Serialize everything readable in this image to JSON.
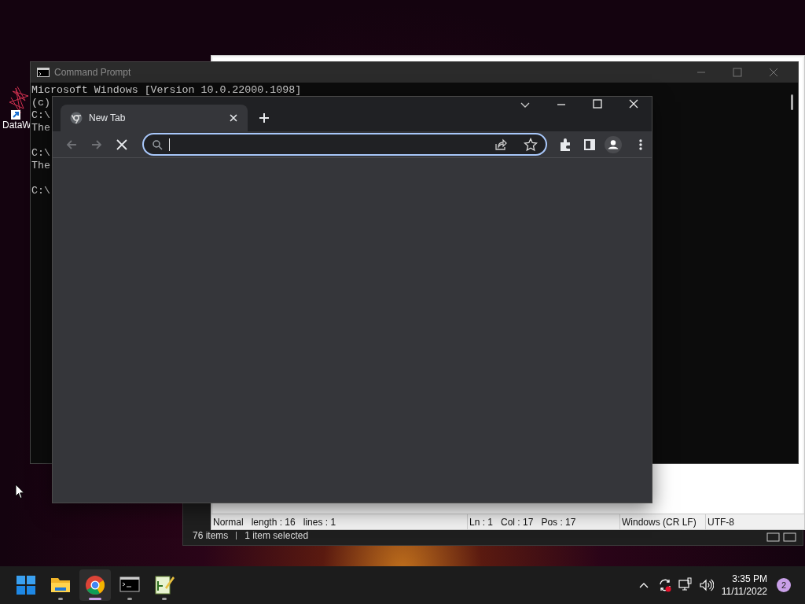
{
  "desktop": {
    "icons": [
      {
        "label": "DataW"
      }
    ]
  },
  "explorer": {
    "status": [
      "76 items",
      "1 item selected"
    ]
  },
  "notepad": {
    "status": [
      {
        "kind": "main",
        "texts": [
          "Normal",
          "length : 16",
          "lines : 1"
        ]
      },
      {
        "kind": "main",
        "texts": [
          "Ln : 1",
          "Col : 17",
          "Pos : 17"
        ]
      },
      {
        "kind": "main",
        "texts": [
          "Windows (CR LF)"
        ]
      },
      {
        "kind": "last",
        "texts": [
          "UTF-8"
        ]
      }
    ]
  },
  "cmd": {
    "title": "Command Prompt",
    "blocks": [
      [
        "Microsoft Windows [Version 10.0.22000.1098]",
        "(c)",
        "C:\\",
        "The"
      ],
      [
        "C:\\",
        "The"
      ],
      [
        "C:\\"
      ]
    ]
  },
  "chrome": {
    "tabs": [
      {
        "label": "New Tab",
        "selected": true
      }
    ],
    "nav": [
      {
        "kind": "back",
        "disabled": true
      },
      {
        "kind": "forward",
        "disabled": true
      },
      {
        "kind": "stop",
        "disabled": false
      }
    ],
    "address": {
      "focused": true
    }
  },
  "taskbar": {
    "apps": [
      {
        "kind": "start",
        "selected": false,
        "running": false
      },
      {
        "kind": "files",
        "selected": false,
        "running": true
      },
      {
        "kind": "browser",
        "selected": true,
        "running": true
      },
      {
        "kind": "terminal",
        "selected": false,
        "running": true
      },
      {
        "kind": "notepad",
        "selected": false,
        "running": true
      }
    ],
    "time": "3:35 PM",
    "date": "11/11/2022",
    "notifications": "2"
  }
}
